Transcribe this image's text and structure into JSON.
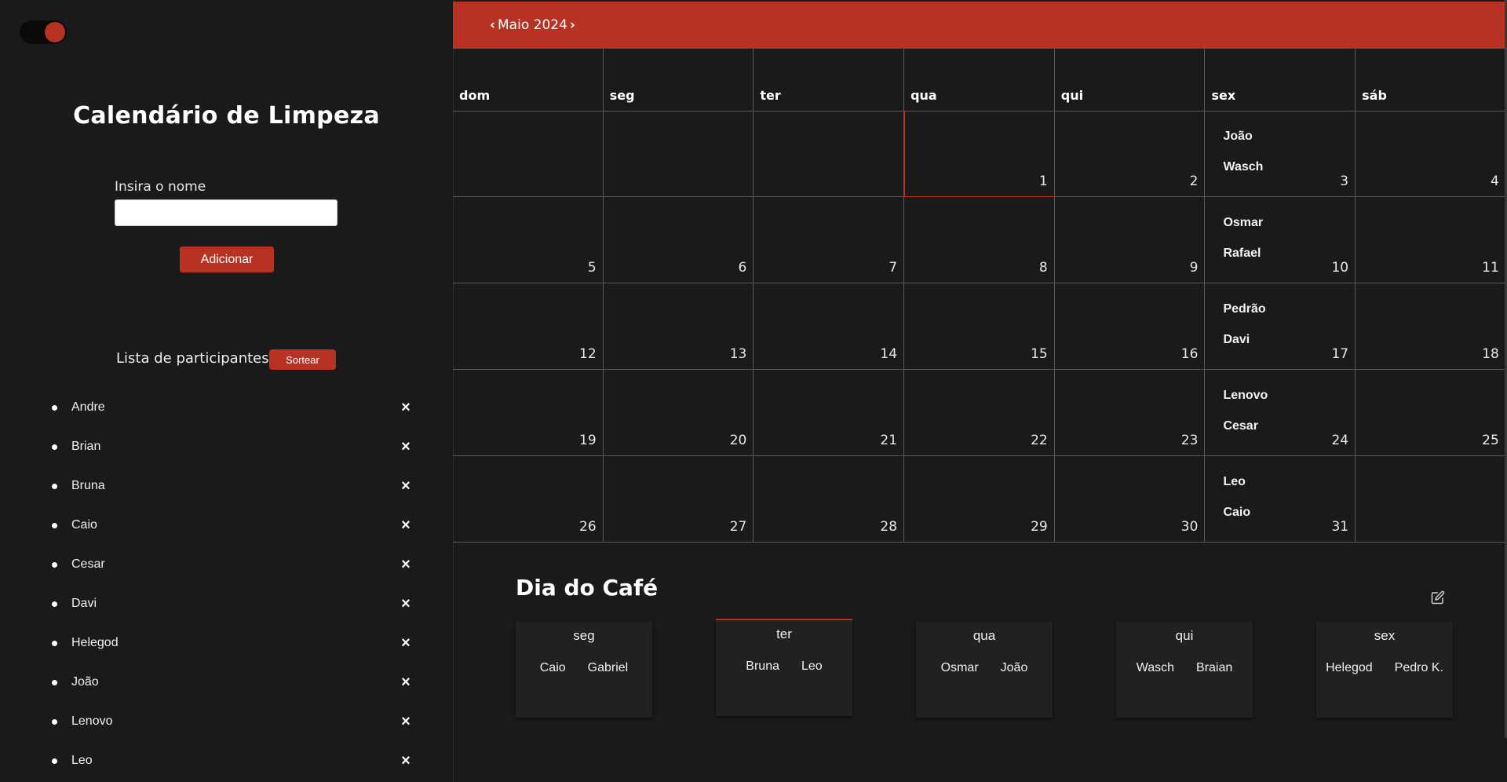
{
  "sidebar": {
    "title": "Calendário de Limpeza",
    "input_label": "Insira o nome",
    "input_value": "",
    "add_button": "Adicionar",
    "participants_label": "Lista de participantes",
    "draw_button": "Sortear",
    "remove_icon": "×",
    "participants": [
      "Andre",
      "Brian",
      "Bruna",
      "Caio",
      "Cesar",
      "Davi",
      "Helegod",
      "João",
      "Lenovo",
      "Leo"
    ]
  },
  "calendar": {
    "prev_icon": "‹",
    "next_icon": "›",
    "month_label": "Maio 2024",
    "weekdays": [
      "dom",
      "seg",
      "ter",
      "qua",
      "qui",
      "sex",
      "sáb"
    ],
    "weeks": [
      [
        {
          "day": ""
        },
        {
          "day": ""
        },
        {
          "day": ""
        },
        {
          "day": "1",
          "today": true
        },
        {
          "day": "2"
        },
        {
          "day": "3",
          "names": [
            "João",
            "Wasch"
          ]
        },
        {
          "day": "4"
        }
      ],
      [
        {
          "day": "5"
        },
        {
          "day": "6"
        },
        {
          "day": "7"
        },
        {
          "day": "8"
        },
        {
          "day": "9"
        },
        {
          "day": "10",
          "names": [
            "Osmar",
            "Rafael"
          ]
        },
        {
          "day": "11"
        }
      ],
      [
        {
          "day": "12"
        },
        {
          "day": "13"
        },
        {
          "day": "14"
        },
        {
          "day": "15"
        },
        {
          "day": "16"
        },
        {
          "day": "17",
          "names": [
            "Pedrão",
            "Davi"
          ]
        },
        {
          "day": "18"
        }
      ],
      [
        {
          "day": "19"
        },
        {
          "day": "20"
        },
        {
          "day": "21"
        },
        {
          "day": "22"
        },
        {
          "day": "23"
        },
        {
          "day": "24",
          "names": [
            "Lenovo",
            "Cesar"
          ]
        },
        {
          "day": "25"
        }
      ],
      [
        {
          "day": "26"
        },
        {
          "day": "27"
        },
        {
          "day": "28"
        },
        {
          "day": "29"
        },
        {
          "day": "30"
        },
        {
          "day": "31",
          "names": [
            "Leo",
            "Caio"
          ]
        },
        {
          "day": ""
        }
      ]
    ]
  },
  "cafe": {
    "title": "Dia do Café",
    "edit_icon": "edit-icon",
    "days": [
      {
        "day": "seg",
        "names": [
          "Caio",
          "Gabriel"
        ]
      },
      {
        "day": "ter",
        "names": [
          "Bruna",
          "Leo"
        ],
        "active": true
      },
      {
        "day": "qua",
        "names": [
          "Osmar",
          "João"
        ]
      },
      {
        "day": "qui",
        "names": [
          "Wasch",
          "Braian"
        ]
      },
      {
        "day": "sex",
        "names": [
          "Helegod",
          "Pedro K."
        ]
      }
    ]
  },
  "colors": {
    "accent": "#b83224",
    "background": "#1a1a1a",
    "card": "#212121"
  }
}
